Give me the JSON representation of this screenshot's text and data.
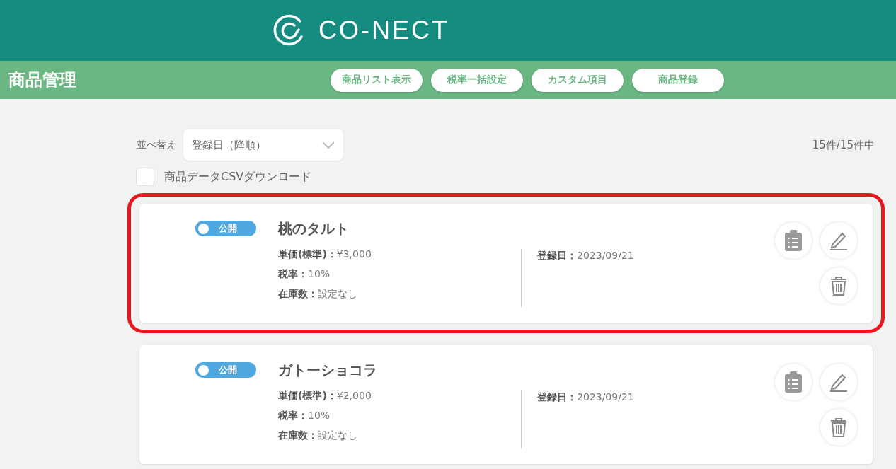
{
  "header": {
    "logo_text": "CO-NECT"
  },
  "subbar": {
    "title": "商品管理",
    "buttons": [
      "商品リスト表示",
      "税率一括設定",
      "カスタム項目",
      "商品登録"
    ]
  },
  "toolbar": {
    "sort_label": "並べ替え",
    "sort_value": "登録日（降順）",
    "count": "15件/15件中",
    "csv": {
      "label": "商品データCSVダウンロード",
      "checked": false
    }
  },
  "products": [
    {
      "status": {
        "label": "公開",
        "on": true
      },
      "name": "桃のタルト",
      "highlighted": true,
      "fields": [
        "**単価(標準)：**¥3,000",
        "**税率：**10%",
        "**在庫数：**設定なし"
      ],
      "date": "**登録日：**2023/09/21"
    },
    {
      "status": {
        "label": "公開",
        "on": true
      },
      "name": "ガトーショコラ",
      "highlighted": false,
      "fields": [
        "**単価(標準)：**¥2,000",
        "**税率：**10%",
        "**在庫数：**設定なし"
      ],
      "date": "**登録日：**2023/09/21"
    }
  ]
}
